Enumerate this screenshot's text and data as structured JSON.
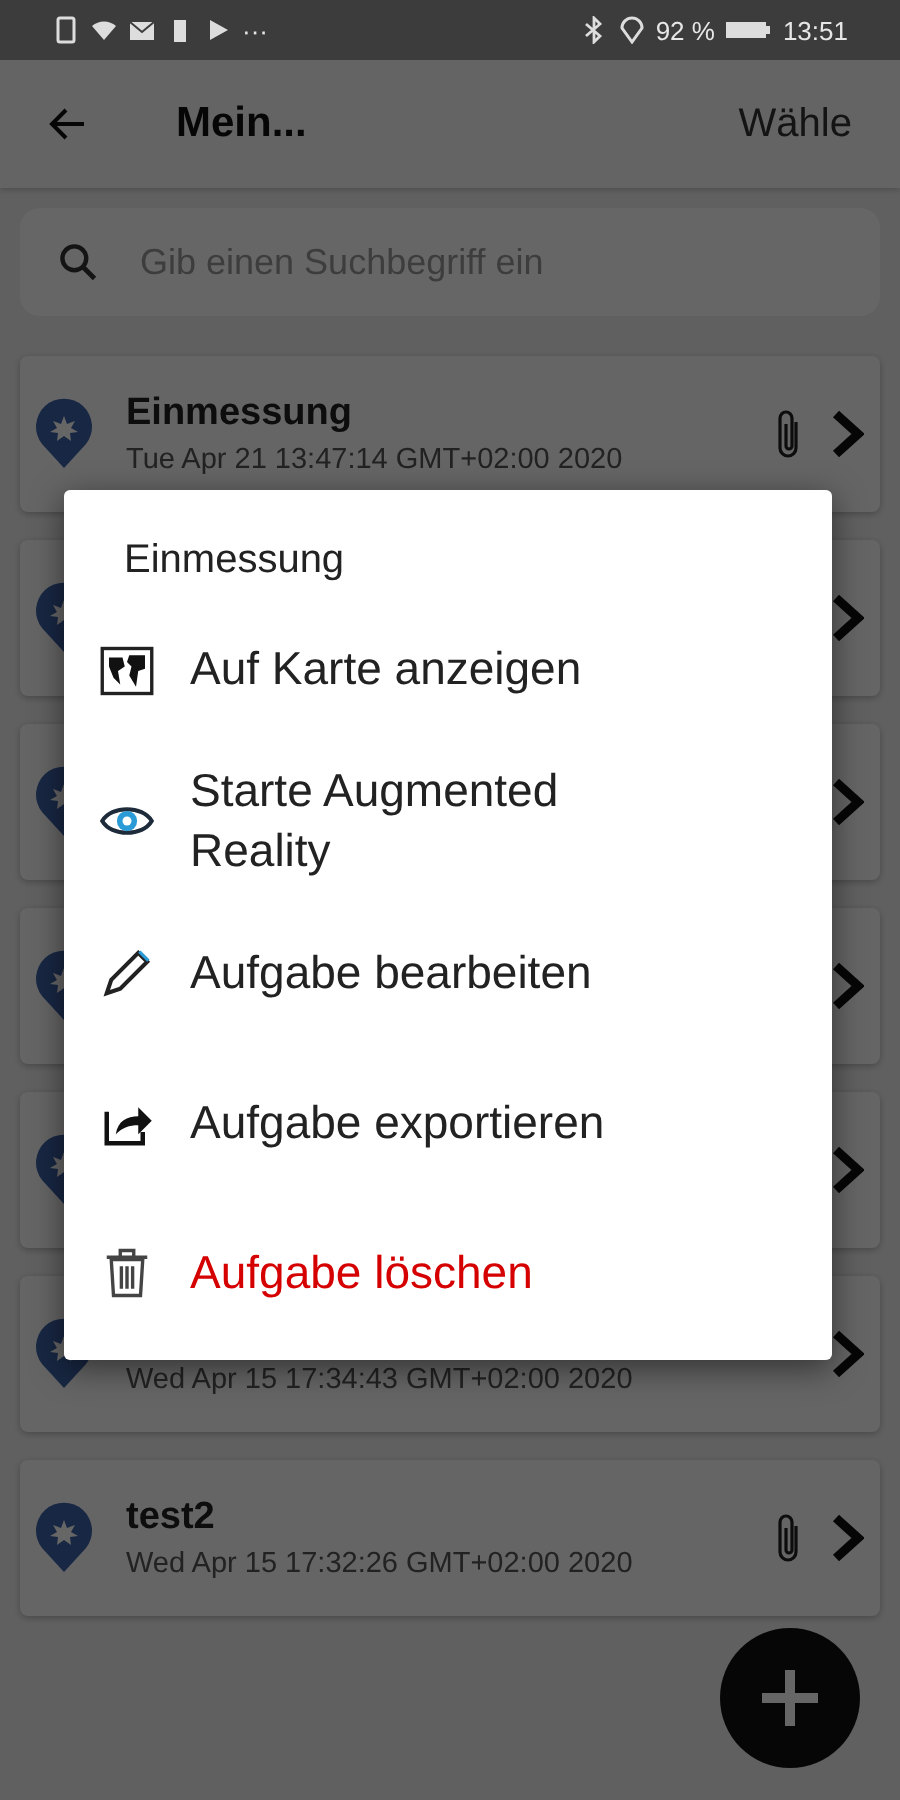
{
  "status_bar": {
    "more": "···",
    "battery": "92 %",
    "time": "13:51"
  },
  "app_bar": {
    "title": "Mein...",
    "action": "Wähle"
  },
  "search": {
    "placeholder": "Gib einen Suchbegriff ein"
  },
  "tasks": [
    {
      "kind": "task",
      "title": "Einmessung",
      "date": "Tue Apr 21 13:47:14 GMT+02:00 2020",
      "attachment": true
    },
    {
      "kind": "task"
    },
    {
      "kind": "task"
    },
    {
      "kind": "task"
    },
    {
      "kind": "task"
    },
    {
      "kind": "task",
      "date": "Wed Apr 15 17:34:43 GMT+02:00 2020"
    },
    {
      "kind": "task",
      "title": "test2",
      "date": "Wed Apr 15 17:32:26 GMT+02:00 2020",
      "attachment": true
    }
  ],
  "dialog": {
    "title": "Einmessung",
    "items": [
      {
        "kind": "map",
        "label": "Auf Karte anzeigen",
        "destructive": false
      },
      {
        "kind": "ar",
        "label": "Starte Augmented Reality",
        "destructive": false
      },
      {
        "kind": "edit",
        "label": "Aufgabe bearbeiten",
        "destructive": false
      },
      {
        "kind": "export",
        "label": "Aufgabe exportieren",
        "destructive": false
      },
      {
        "kind": "delete",
        "label": "Aufgabe löschen",
        "destructive": true
      }
    ]
  }
}
